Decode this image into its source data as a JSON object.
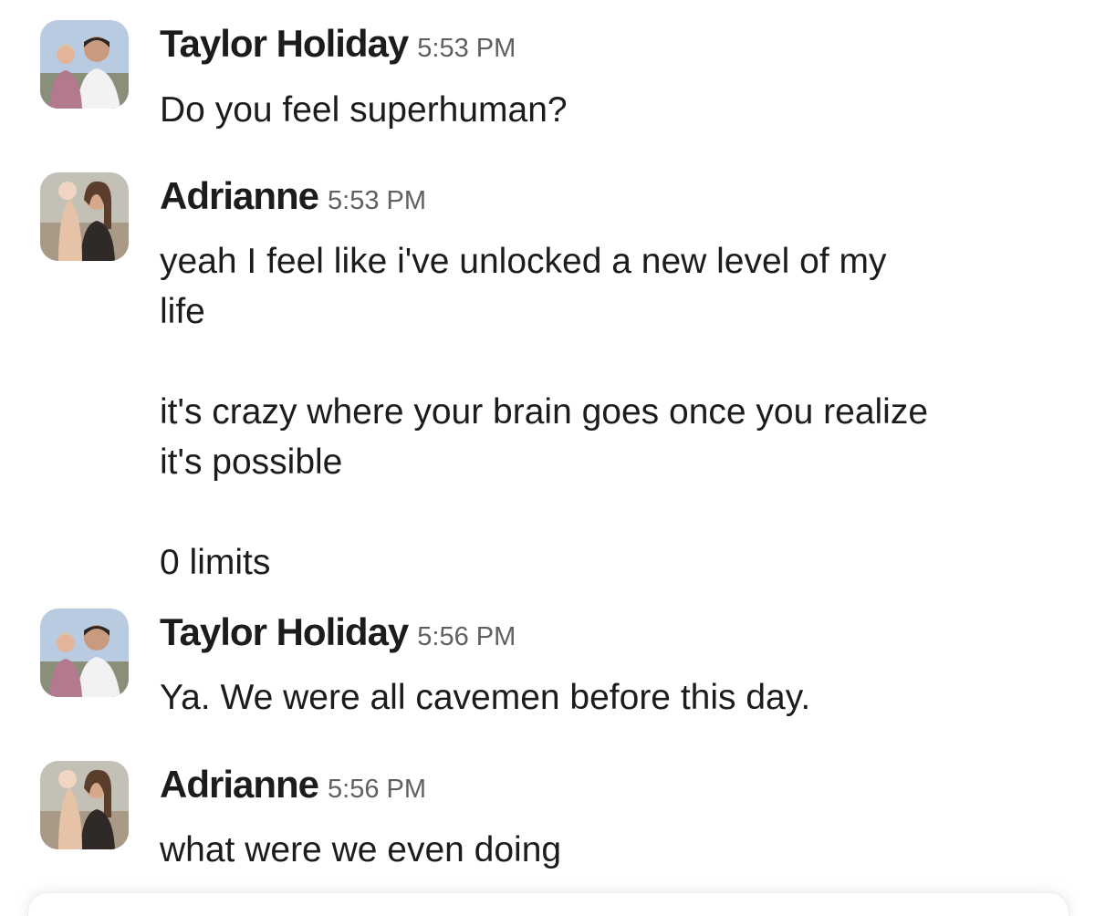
{
  "messages": [
    {
      "author": "Taylor Holiday",
      "time": "5:53 PM",
      "avatar": "taylor-avatar",
      "lines": [
        "Do you feel superhuman?"
      ]
    },
    {
      "author": "Adrianne",
      "time": "5:53 PM",
      "avatar": "adrianne-avatar",
      "lines": [
        "yeah I feel like i've unlocked a new level of my",
        "life",
        "",
        "it's crazy where your brain goes once you realize",
        "it's possible",
        "",
        "0 limits"
      ]
    },
    {
      "author": "Taylor Holiday",
      "time": "5:56 PM",
      "avatar": "taylor-avatar",
      "lines": [
        "Ya. We were all cavemen before this day."
      ]
    },
    {
      "author": "Adrianne",
      "time": "5:56 PM",
      "avatar": "adrianne-avatar",
      "lines": [
        "what were we even doing"
      ]
    }
  ],
  "colors": {
    "name": "#1d1c1d",
    "timestamp": "#616061",
    "background": "#ffffff"
  }
}
